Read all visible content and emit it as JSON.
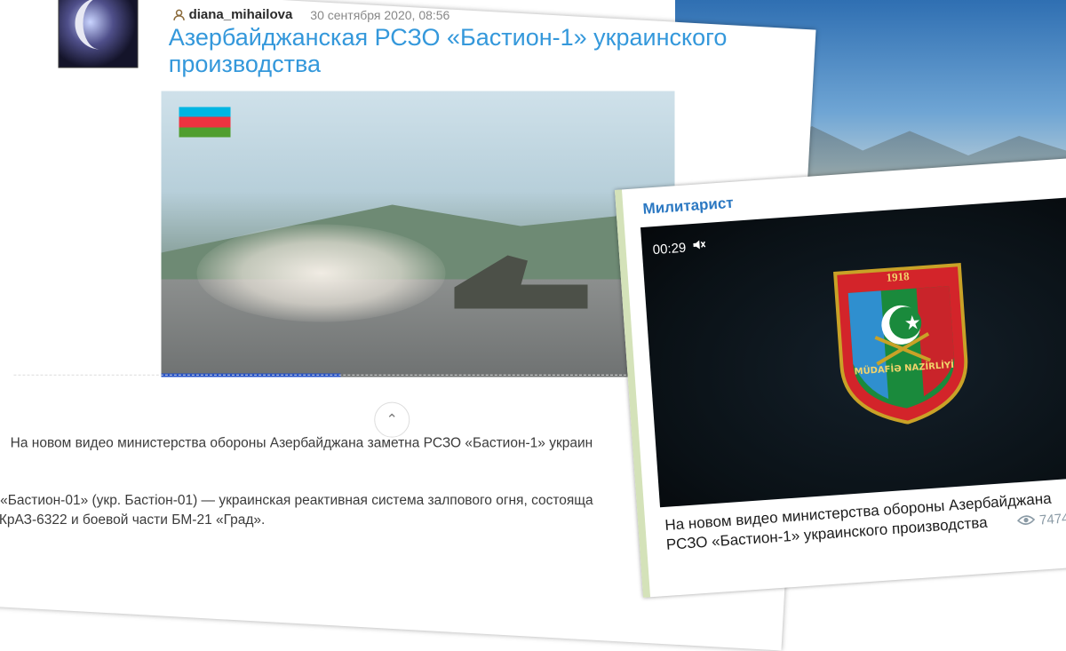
{
  "author": {
    "name": "diana_mihailova",
    "date": "30 сентября 2020, 08:56"
  },
  "article": {
    "title": "Азербайджанская РСЗО «Бастион-1» украинского производства",
    "paragraph1": "На новом видео министерства обороны Азербайджана заметна РСЗО «Бастион-1» украин",
    "paragraph2_line1": "«Бастион-01» (укр. Бастіон-01) — украинская реактивная система залпового огня, состояща",
    "paragraph2_line2": "КрАЗ-6322 и боевой части БМ-21 «Град».",
    "collapse_icon": "chevron-up-icon",
    "video_progress_percent": 35
  },
  "telegram": {
    "channel": "Милитарист",
    "video_time": "00:29",
    "emblem_year": "1918",
    "emblem_text": "MÜDAFİƏ NAZİRLİYİ",
    "text_line1": "На новом видео министерства обороны Азербайджана",
    "text_line2": "РСЗО «Бастион-1» украинского производства",
    "views": "7474"
  },
  "colors": {
    "title_blue": "#3498db",
    "channel_blue": "#2b78c2"
  }
}
